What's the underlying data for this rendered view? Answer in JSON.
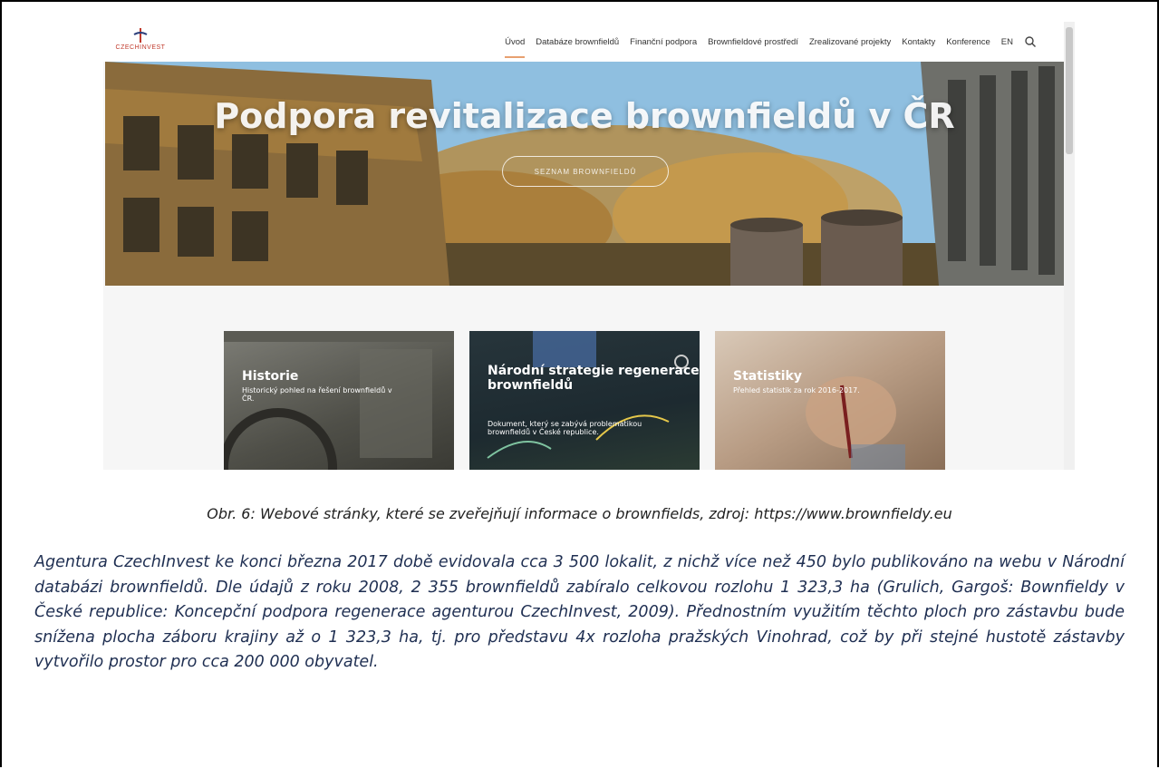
{
  "site": {
    "logo_text": "CZECHINVEST",
    "nav": [
      {
        "label": "Úvod",
        "active": true
      },
      {
        "label": "Databáze brownfieldů",
        "active": false
      },
      {
        "label": "Finanční podpora",
        "active": false
      },
      {
        "label": "Brownfieldové prostředí",
        "active": false
      },
      {
        "label": "Zrealizované projekty",
        "active": false
      },
      {
        "label": "Kontakty",
        "active": false
      },
      {
        "label": "Konference",
        "active": false
      },
      {
        "label": "EN",
        "active": false
      }
    ],
    "search_icon": "search-icon",
    "accent_color": "#e8a070",
    "hero": {
      "title": "Podpora revitalizace brownfieldů v ČR",
      "button": "SEZNAM BROWNFIELDŮ"
    },
    "cards": [
      {
        "title": "Historie",
        "desc": "Historický pohled na řešení brownfieldů v ČR."
      },
      {
        "title": "Národní strategie regenerace brownfieldů",
        "desc": "Dokument, který se zabývá problematikou brownfieldů v České republice."
      },
      {
        "title": "Statistiky",
        "desc": "Přehled statistik za rok 2016-2017."
      }
    ]
  },
  "document": {
    "caption": "Obr. 6: Webové stránky, které se zveřejňují informace o brownfields, zdroj: https://www.brownfieldy.eu",
    "paragraph": "Agentura CzechInvest ke konci března 2017 době evidovala cca 3 500 lokalit, z nichž více než 450 bylo publikováno na webu v Národní databázi brownfieldů. Dle údajů z roku 2008, 2 355 brownfieldů zabíralo celkovou rozlohu 1 323,3 ha (Grulich, Gargoš: Bownfieldy v České republice: Koncepční podpora regenerace agenturou CzechInvest, 2009). Přednostním využitím těchto ploch pro zástavbu bude snížena plocha záboru krajiny až o 1 323,3 ha, tj. pro představu 4x rozloha pražských Vinohrad, což by při stejné hustotě zástavby vytvořilo prostor pro cca 200 000 obyvatel."
  }
}
